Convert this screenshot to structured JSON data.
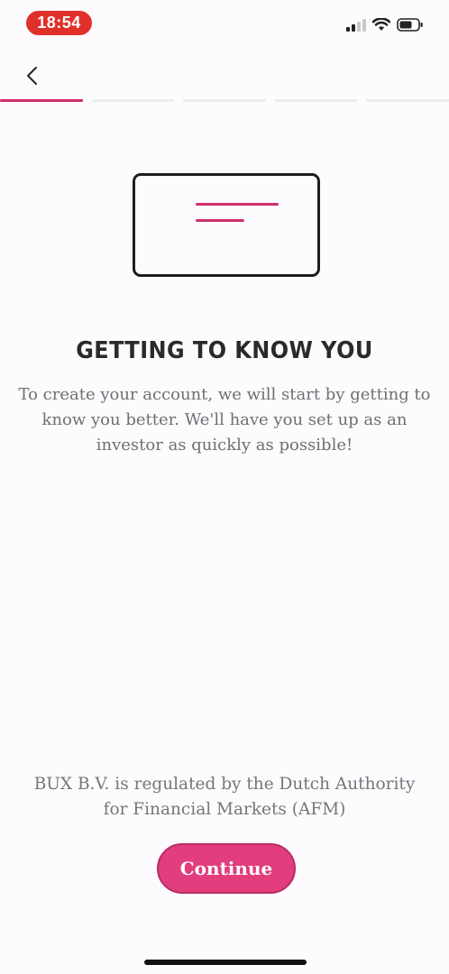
{
  "status_bar": {
    "time": "18:54",
    "time_pill_color": "#e0302a",
    "icons": [
      "signal-icon",
      "wifi-icon",
      "battery-icon"
    ]
  },
  "nav": {
    "back_icon": "chevron-left-icon",
    "progress": {
      "total_steps": 5,
      "current_step": 1,
      "active_color": "#cf2f6e"
    }
  },
  "illustration": {
    "icon": "card-icon",
    "accent_color": "#cf2f6e"
  },
  "content": {
    "headline": "GETTING TO KNOW YOU",
    "subtitle": "To create your account, we will start by getting to know you better. We'll have you set up as an investor as quickly as possible!"
  },
  "footer": {
    "regulation": "BUX B.V. is regulated by the Dutch Authority for Financial Markets (AFM)",
    "continue_label": "Continue",
    "button_color": "#e23d7d"
  }
}
